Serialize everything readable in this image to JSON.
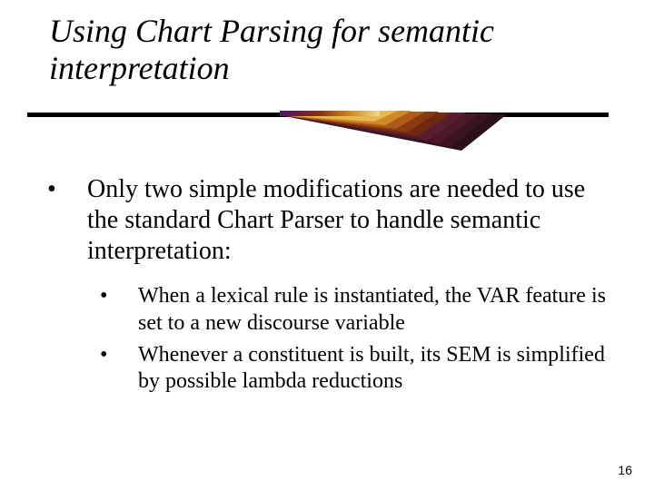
{
  "title": "Using Chart Parsing for semantic interpretation",
  "bullets": {
    "main": "Only two simple modifications are needed to use the standard Chart Parser to handle semantic interpretation:",
    "sub": [
      "When a lexical rule is instantiated, the VAR feature is set to a new discourse variable",
      "Whenever a constituent is built, its SEM is simplified by possible lambda reductions"
    ]
  },
  "page_number": "16",
  "decoration": {
    "rule_color": "#000000",
    "gradient_stops": [
      "#5a1a7a",
      "#7a1a35",
      "#b04a10",
      "#e0a040",
      "#f6e2a8"
    ]
  }
}
